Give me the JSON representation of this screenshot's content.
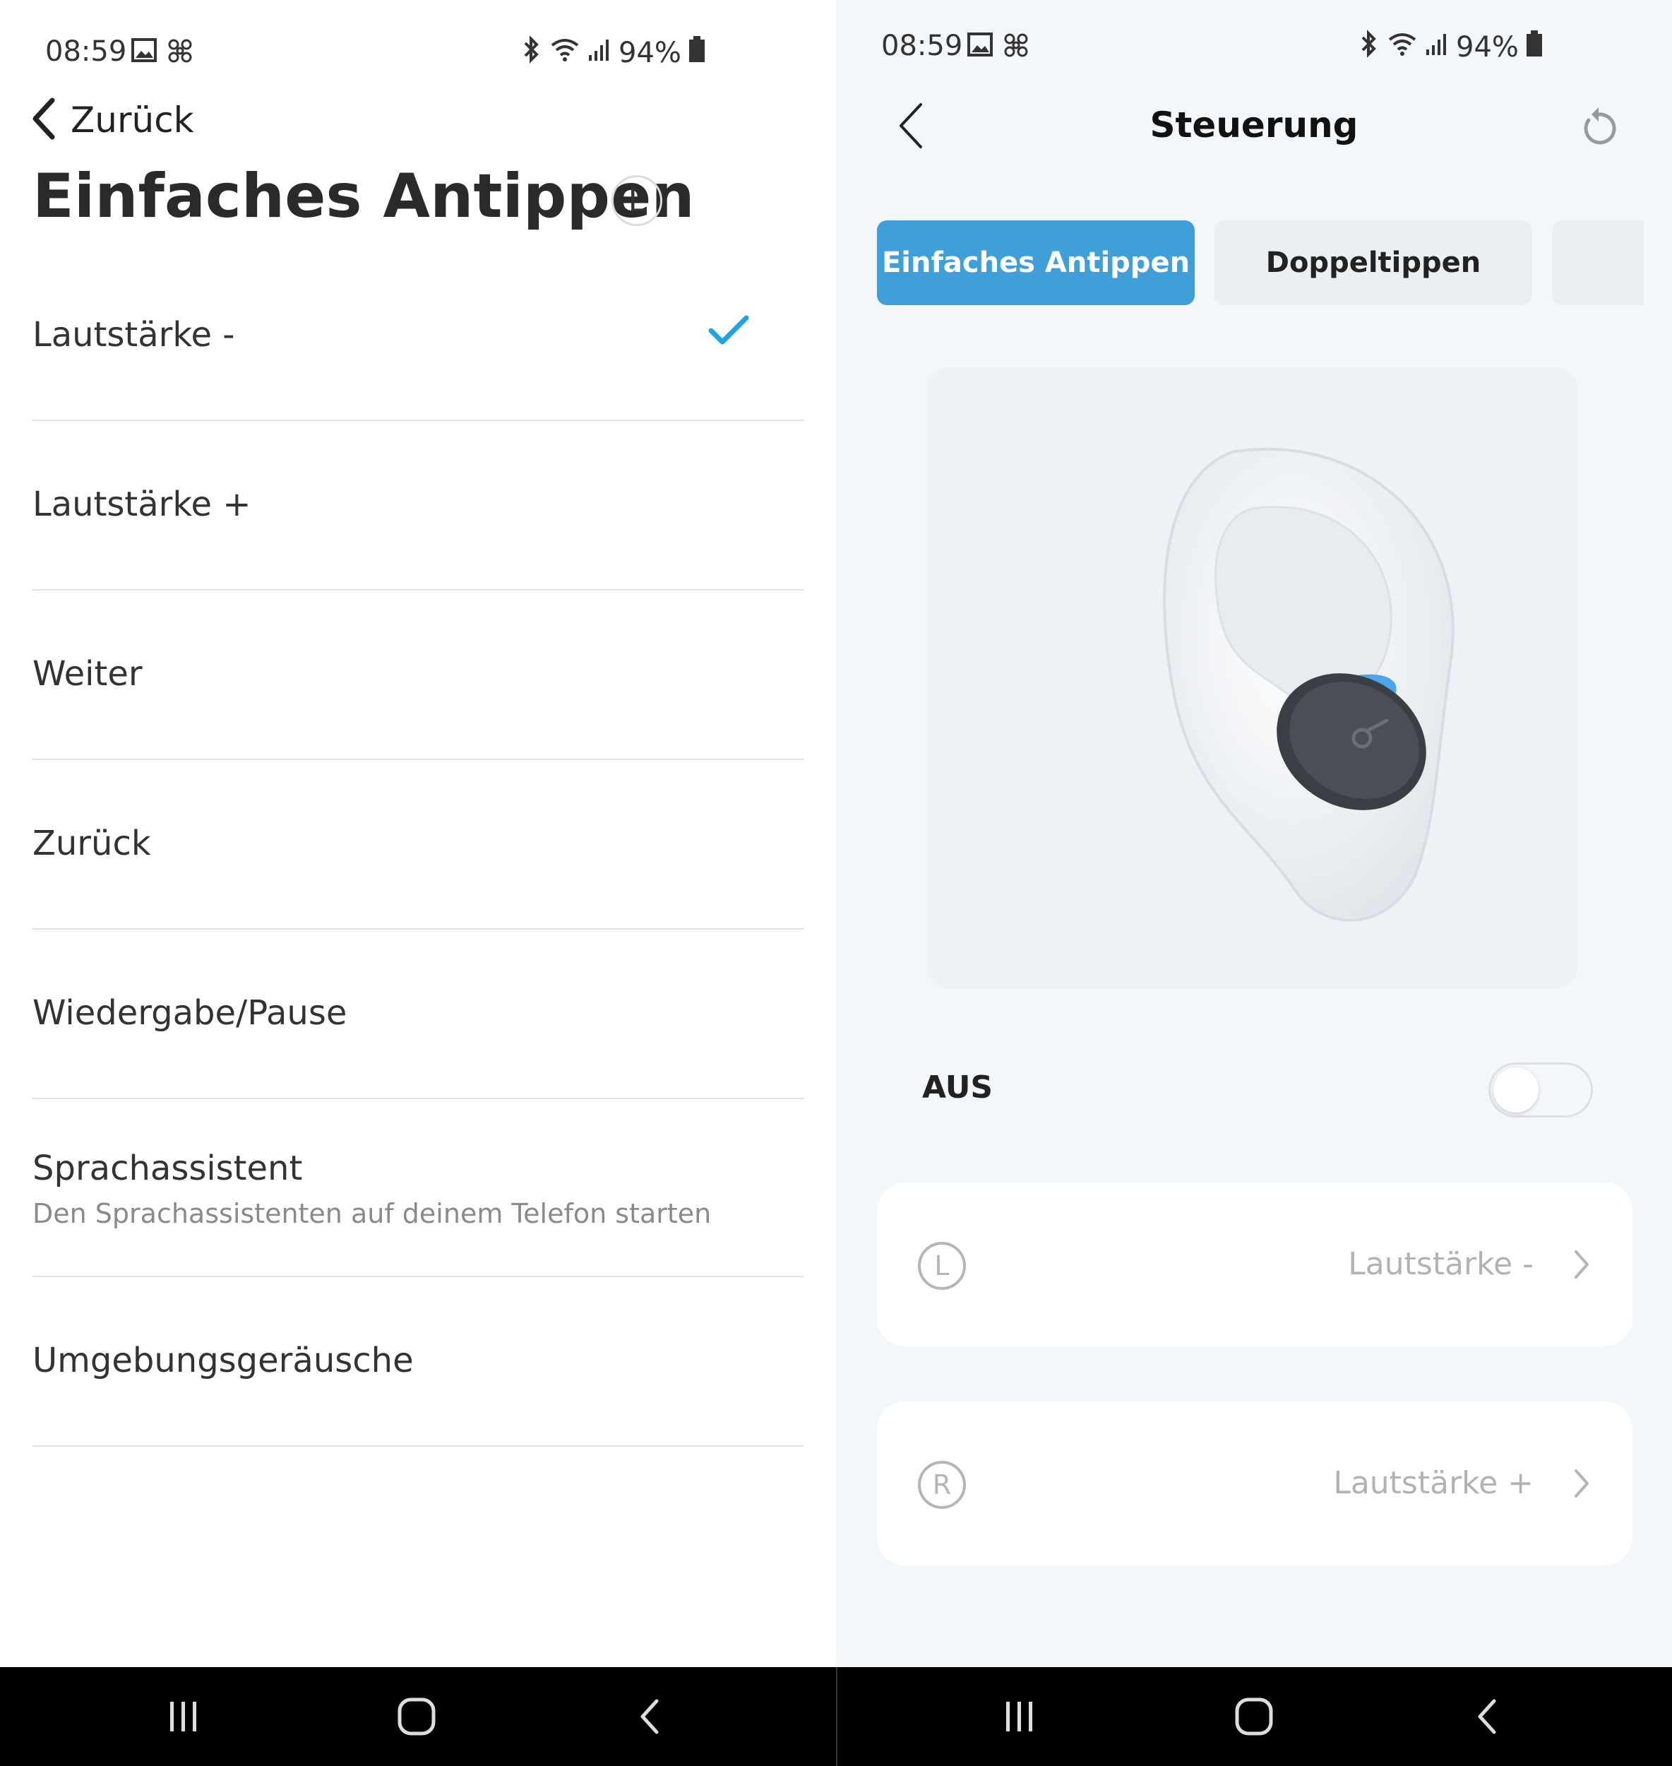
{
  "colors": {
    "accent": "#3f9fd8",
    "checkmark": "#1ea5e0",
    "navbar_bg": "#000000",
    "right_bg": "#f4f7fa",
    "earbud_accent": "#4aa8ea"
  },
  "left": {
    "status": {
      "time": "08:59",
      "battery": "94%"
    },
    "back_label": "Zurück",
    "title": "Einfaches Antippen",
    "side_badge": "L",
    "options": [
      {
        "label": "Lautstärke -",
        "selected": true
      },
      {
        "label": "Lautstärke +"
      },
      {
        "label": "Weiter"
      },
      {
        "label": "Zurück"
      },
      {
        "label": "Wiedergabe/Pause"
      },
      {
        "label": "Sprachassistent",
        "description": "Den Sprachassistenten auf deinem Telefon starten"
      },
      {
        "label": "Umgebungsgeräusche"
      }
    ]
  },
  "right": {
    "status": {
      "time": "08:59",
      "battery": "94%"
    },
    "title": "Steuerung",
    "tabs": [
      {
        "label": "Einfaches Antippen",
        "active": true
      },
      {
        "label": "Doppeltippen",
        "active": false
      }
    ],
    "toggle": {
      "label": "AUS",
      "on": false
    },
    "cards": [
      {
        "side": "L",
        "value": "Lautstärke -"
      },
      {
        "side": "R",
        "value": "Lautstärke +"
      }
    ]
  }
}
